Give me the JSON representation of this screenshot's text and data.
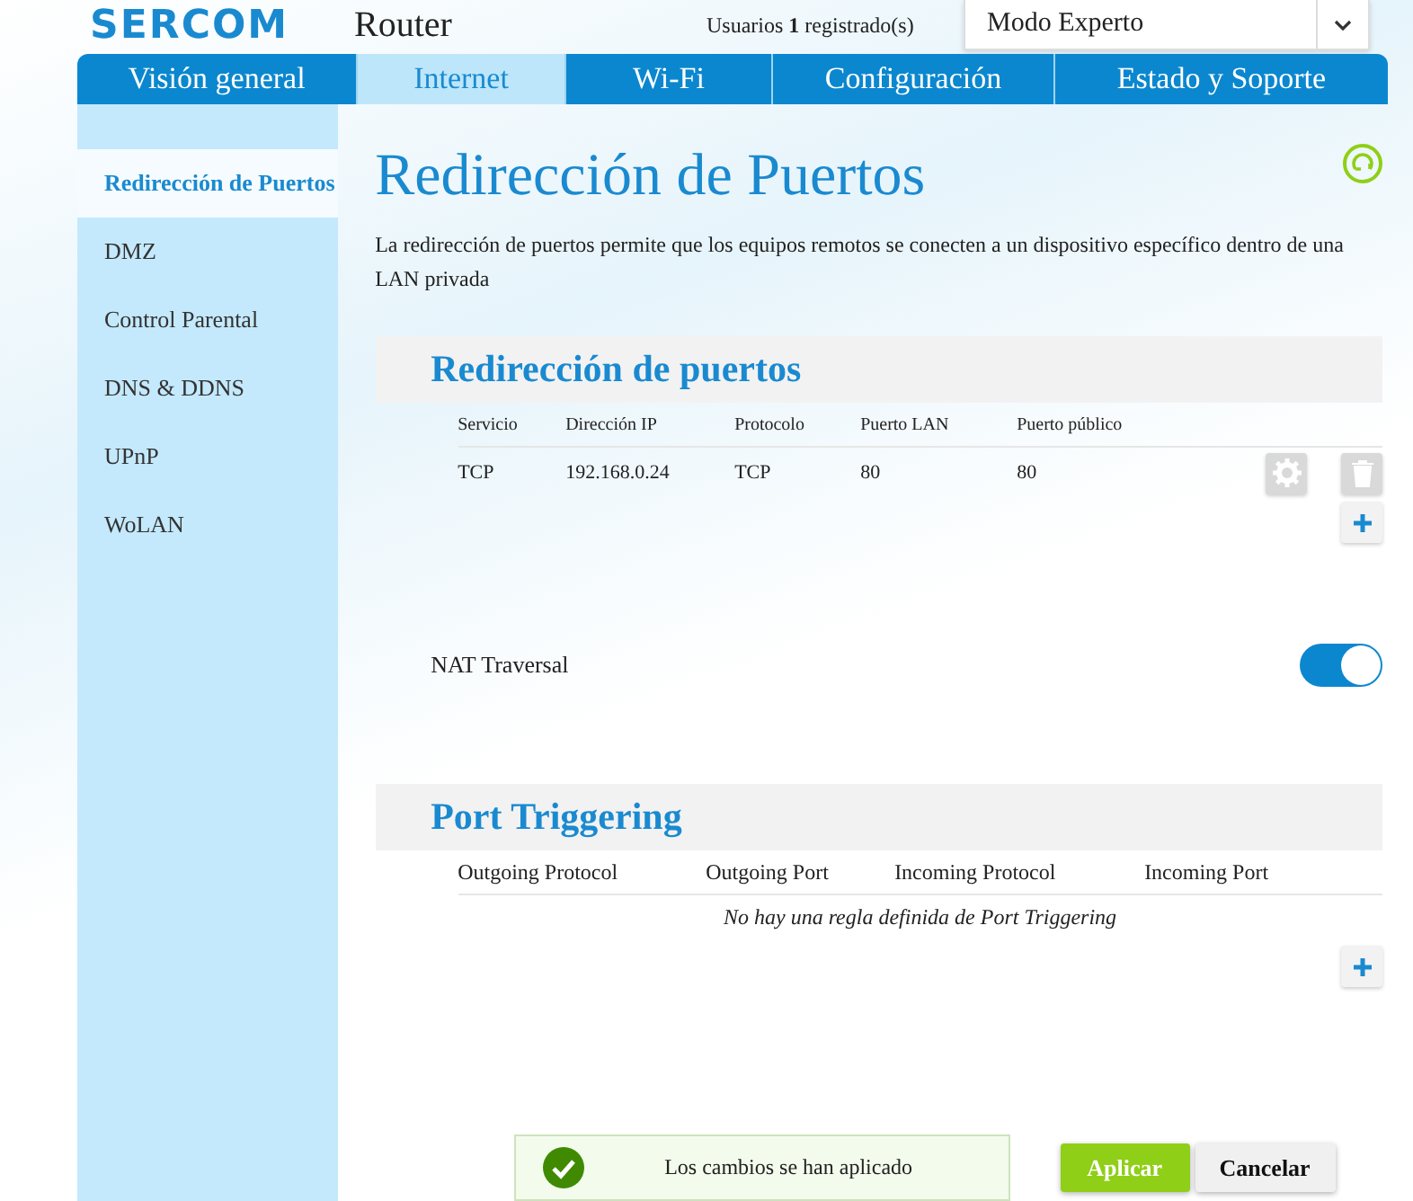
{
  "header": {
    "brand": "SERCOM",
    "product": "Router",
    "users": "Usuarios **1** registrado(s)",
    "mode": "Modo Experto"
  },
  "tabs": [
    {
      "label": "Visión general",
      "selected": false
    },
    {
      "label": "Internet",
      "selected": true
    },
    {
      "label": "Wi-Fi",
      "selected": false
    },
    {
      "label": "Configuración",
      "selected": false
    },
    {
      "label": "Estado y Soporte",
      "selected": false
    }
  ],
  "sidebar": {
    "items": [
      {
        "label": "Redirección de Puertos",
        "selected": true
      },
      {
        "label": "DMZ",
        "selected": false
      },
      {
        "label": "Control Parental",
        "selected": false
      },
      {
        "label": "DNS & DDNS",
        "selected": false
      },
      {
        "label": "UPnP",
        "selected": false
      },
      {
        "label": "WoLAN",
        "selected": false
      }
    ]
  },
  "page": {
    "title": "Redirección de Puertos",
    "description": "La redirección de puertos permite que los equipos remotos se conecten a un dispositivo específico dentro de una LAN privada"
  },
  "port_forwarding": {
    "title": "Redirección de puertos",
    "columns": [
      "Servicio",
      "Dirección IP",
      "Protocolo",
      "Puerto LAN",
      "Puerto público"
    ],
    "rows": [
      [
        "TCP",
        "192.168.0.24",
        "TCP",
        "80",
        "80"
      ]
    ]
  },
  "nat_traversal": {
    "label": "NAT Traversal",
    "on": true
  },
  "port_triggering": {
    "title": "Port Triggering",
    "columns": [
      "Outgoing Protocol",
      "Outgoing Port",
      "Incoming Protocol",
      "Incoming Port"
    ],
    "empty_message": "No hay una regla definida de Port Triggering"
  },
  "footer": {
    "notice": "Los cambios se han aplicado",
    "apply": "Aplicar",
    "cancel": "Cancelar"
  }
}
